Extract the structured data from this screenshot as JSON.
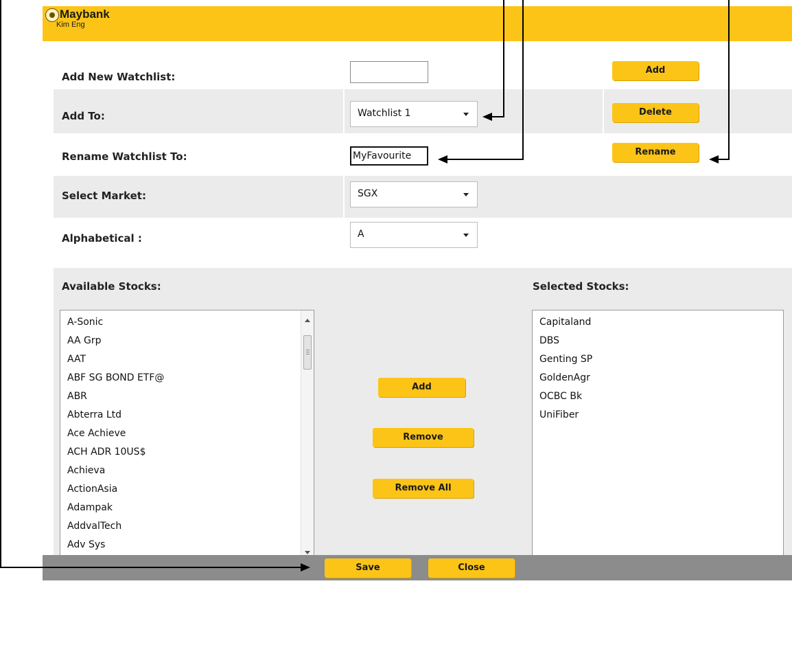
{
  "brand": {
    "name": "Maybank",
    "sub": "Kim Eng"
  },
  "form": {
    "add_new_label": "Add New Watchlist:",
    "add_new_value": "",
    "add_button": "Add",
    "add_to_label": "Add To:",
    "add_to_value": "Watchlist 1",
    "delete_button": "Delete",
    "rename_label": "Rename Watchlist To:",
    "rename_value": "MyFavourite",
    "rename_button": "Rename",
    "market_label": "Select Market:",
    "market_value": "SGX",
    "alpha_label": "Alphabetical :",
    "alpha_value": "A"
  },
  "stocks": {
    "available_label": "Available Stocks:",
    "selected_label": "Selected Stocks:",
    "available": [
      "A-Sonic",
      "AA Grp",
      "AAT",
      "ABF SG BOND ETF@",
      "ABR",
      "Abterra Ltd",
      "Ace Achieve",
      "ACH ADR 10US$",
      "Achieva",
      "ActionAsia",
      "Adampak",
      "AddvalTech",
      "Adv Sys"
    ],
    "selected": [
      "Capitaland",
      "DBS",
      "Genting SP",
      "GoldenAgr",
      "OCBC Bk",
      "UniFiber"
    ],
    "add_button": "Add",
    "remove_button": "Remove",
    "remove_all_button": "Remove All"
  },
  "footer": {
    "save_button": "Save",
    "close_button": "Close"
  },
  "colors": {
    "accent": "#fcc417",
    "panel": "#ebebeb",
    "footer": "#8c8c8c"
  }
}
